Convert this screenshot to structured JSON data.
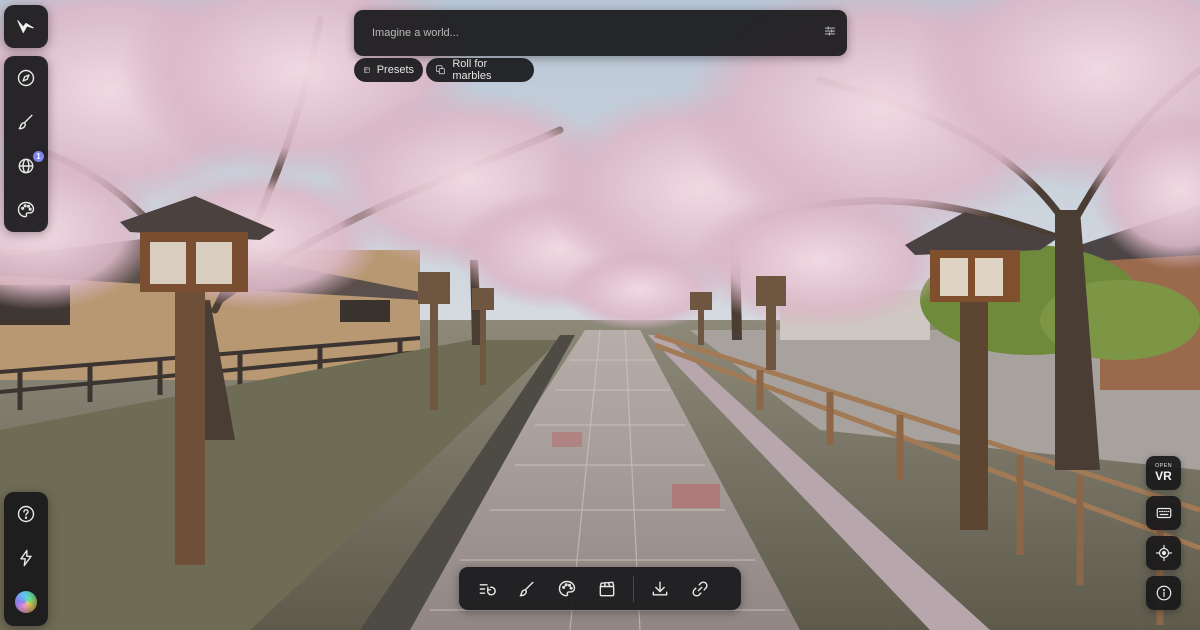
{
  "app": {
    "logo_icon": "w-logo-icon"
  },
  "left_toolbar": {
    "items": [
      {
        "icon": "compass-icon",
        "badge": ""
      },
      {
        "icon": "brush-icon",
        "badge": ""
      },
      {
        "icon": "globe-icon",
        "badge": "1"
      },
      {
        "icon": "palette-icon",
        "badge": ""
      }
    ]
  },
  "left_bottom": {
    "items": [
      {
        "icon": "help-icon"
      },
      {
        "icon": "lightning-icon"
      },
      {
        "icon": "color-orb-icon"
      }
    ]
  },
  "prompt": {
    "placeholder": "Imagine a world...",
    "value": "",
    "settings_icon": "sliders-icon"
  },
  "chips": {
    "presets_label": "Presets",
    "roll_label": "Roll for marbles"
  },
  "bottom_toolbar": {
    "items": [
      "history-icon",
      "brush-icon",
      "palette-icon",
      "clapperboard-icon",
      "download-icon",
      "link-icon"
    ]
  },
  "right_controls": {
    "vr_top": "OPEN",
    "vr_main": "VR",
    "items": [
      "keyboard-icon",
      "locate-icon",
      "info-icon"
    ]
  },
  "colors": {
    "panel_bg": "#18181a",
    "badge": "#7d86f0",
    "blossom": "#e7c8d4",
    "sky": "#c9d3de"
  }
}
